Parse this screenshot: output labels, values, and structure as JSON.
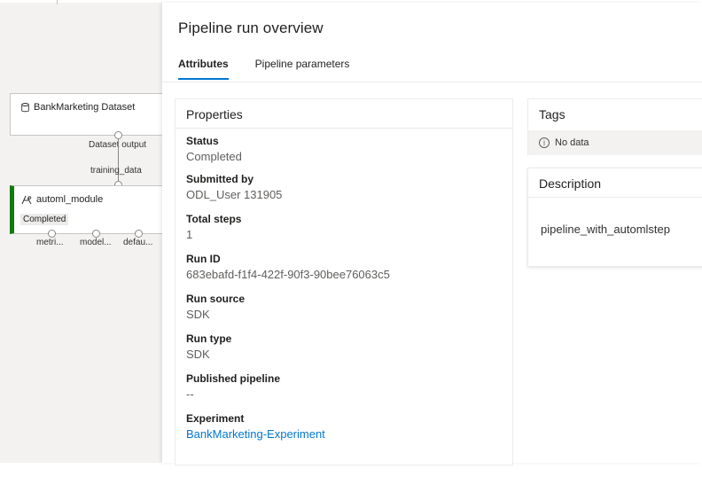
{
  "canvas": {
    "dataset_node": {
      "title": "BankMarketing Dataset",
      "output_port_label": "Dataset output"
    },
    "automl_node": {
      "input_port_label": "training_data",
      "title": "automl_module",
      "status": "Completed",
      "output_ports": [
        "metri...",
        "model...",
        "defau..."
      ]
    }
  },
  "panel": {
    "title": "Pipeline run overview",
    "tabs": [
      {
        "label": "Attributes",
        "active": true
      },
      {
        "label": "Pipeline parameters",
        "active": false
      }
    ],
    "properties": {
      "header": "Properties",
      "items": [
        {
          "label": "Status",
          "value": "Completed"
        },
        {
          "label": "Submitted by",
          "value": "ODL_User 131905"
        },
        {
          "label": "Total steps",
          "value": "1"
        },
        {
          "label": "Run ID",
          "value": "683ebafd-f1f4-422f-90f3-90bee76063c5"
        },
        {
          "label": "Run source",
          "value": "SDK"
        },
        {
          "label": "Run type",
          "value": "SDK"
        },
        {
          "label": "Published pipeline",
          "value": "--"
        },
        {
          "label": "Experiment",
          "value": "BankMarketing-Experiment"
        }
      ]
    },
    "tags": {
      "header": "Tags",
      "empty_text": "No data",
      "icon": "info-icon"
    },
    "description": {
      "header": "Description",
      "text": "pipeline_with_automlstep"
    }
  },
  "colors": {
    "accent": "#0078d4",
    "success": "#107c10",
    "canvas_bg": "#f3f2f1"
  }
}
